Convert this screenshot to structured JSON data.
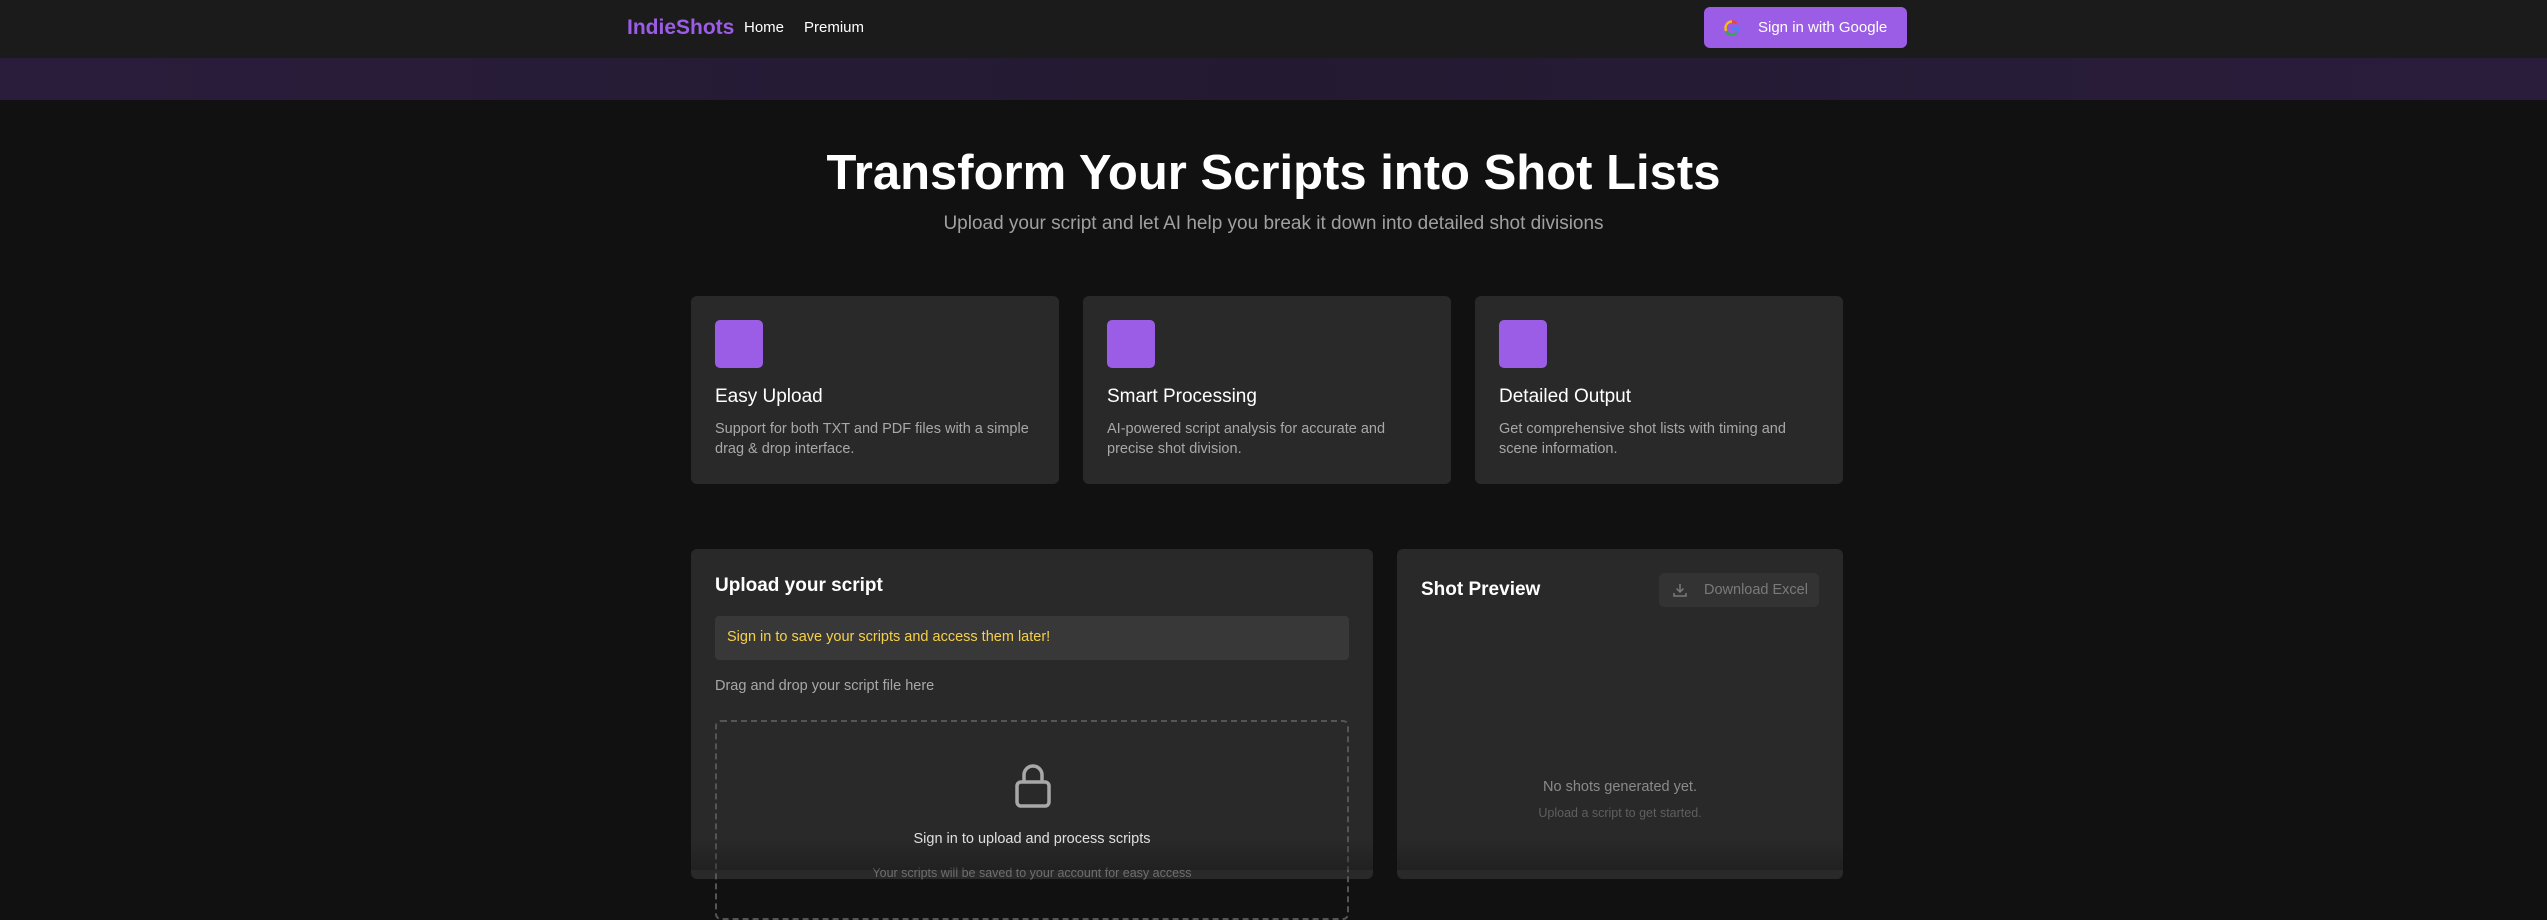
{
  "nav": {
    "brand": "IndieShots",
    "links": [
      {
        "label": "Home"
      },
      {
        "label": "Premium"
      }
    ],
    "signin_label": "Sign in with Google"
  },
  "hero": {
    "title": "Transform Your Scripts into Shot Lists",
    "subtitle": "Upload your script and let AI help you break it down into detailed shot divisions"
  },
  "features": [
    {
      "title": "Easy Upload",
      "description": "Support for both TXT and PDF files with a simple drag & drop interface."
    },
    {
      "title": "Smart Processing",
      "description": "AI-powered script analysis for accurate and precise shot division."
    },
    {
      "title": "Detailed Output",
      "description": "Get comprehensive shot lists with timing and scene information."
    }
  ],
  "upload": {
    "title": "Upload your script",
    "notice": "Sign in to save your scripts and access them later!",
    "drag_label": "Drag and drop your script file here",
    "drop_text": "Sign in to upload and process scripts",
    "drop_sub": "Your scripts will be saved to your account for easy access"
  },
  "preview": {
    "title": "Shot Preview",
    "download_label": "Download Excel",
    "empty_title": "No shots generated yet.",
    "empty_sub": "Upload a script to get started."
  },
  "colors": {
    "accent": "#9b5de5",
    "notice_text": "#f5d04a",
    "background": "#111111",
    "card": "#292929"
  },
  "icons": {
    "google": "google-icon",
    "lock": "lock-icon",
    "download": "download-icon"
  }
}
